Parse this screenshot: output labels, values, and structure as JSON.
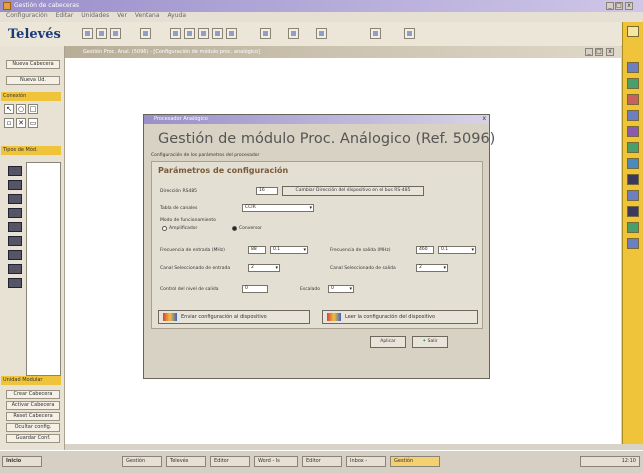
{
  "window": {
    "title": "Gestión de cabeceras"
  },
  "menu": [
    "Configuración",
    "Editar",
    "Unidades",
    "Ver",
    "Ventana",
    "Ayuda"
  ],
  "logo": "Televés",
  "left_panel": {
    "buttons": [
      "Nueva Cabecera",
      "Nueva Ud."
    ],
    "headers": [
      "Conexión",
      "Tipos de Mód."
    ],
    "bottom_header": "Unidad Modular",
    "bottom_buttons": [
      "Crear Cabecera",
      "Activar Cabecera",
      "Reset Cabecera",
      "Ocultar config.",
      "Guardar Conf."
    ]
  },
  "doc_window": {
    "title": "Gestión Proc. Anal. (5096) - [Configuración de módulo proc. analógico]"
  },
  "dialog": {
    "bar_title": "Procesador Analógico",
    "close": "x",
    "title": "Gestión de módulo Proc. Análogico (Ref. 5096)",
    "subtitle": "Configuración de los parámetros del procesador",
    "section_title": "Parámetros de configuración",
    "rs485": {
      "label": "Dirección RS485",
      "value": "16",
      "button": "Cambiar Dirección del dispositivo en el bus RS-485"
    },
    "channel_table": {
      "label": "Tabla de canales",
      "value": "CCIR"
    },
    "mode": {
      "label": "Modo de funcionamiento",
      "options": [
        "Amplificador",
        "Conversor"
      ]
    },
    "freq_in": {
      "label": "Frecuencia de entrada (MHz)",
      "value": "88",
      "value2": "0.1"
    },
    "freq_out": {
      "label": "Frecuencia de salida (MHz)",
      "value": "460",
      "value2": "0.1"
    },
    "chan_in": {
      "label": "Canal Seleccionado de entrada",
      "value": "2"
    },
    "chan_out": {
      "label": "Canal Seleccionado de salida",
      "value": "2"
    },
    "out_level": {
      "label": "Control del nivel de salida",
      "value": "0"
    },
    "scale": {
      "label": "Escalado",
      "value": "0"
    },
    "send_button": "Enviar configuración al dispositivo",
    "read_button": "Leer la configuración del dispositivo",
    "apply_button": "Aplicar",
    "exit_button": "Salir"
  },
  "taskbar": {
    "start": "Inicio",
    "tasks": [
      "Gestión",
      "Televés",
      "Editor",
      "Word - Is",
      "Editor",
      "Inbox -",
      "Gestión"
    ],
    "clock": "12:10"
  }
}
